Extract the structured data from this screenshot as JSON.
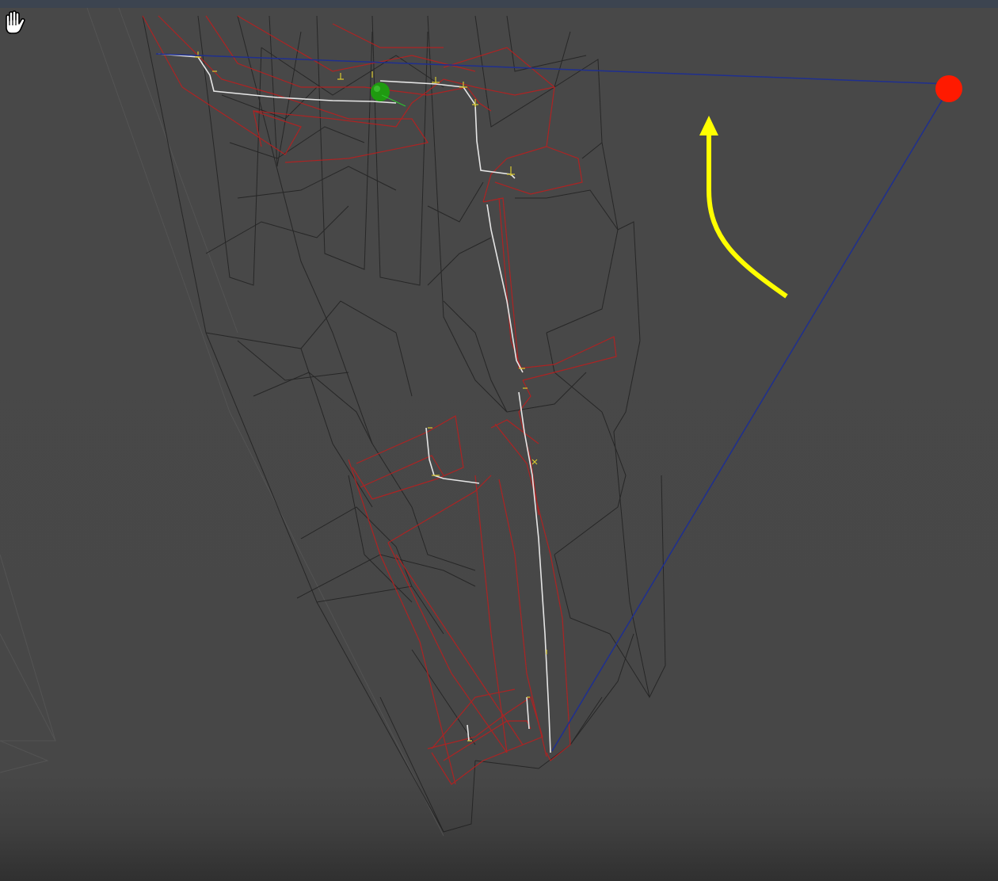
{
  "viewport": {
    "mode": "wireframe",
    "background_color": "#474747",
    "mesh_color": "#1a1a1a",
    "highlight_mesh_color": "#b82020",
    "path_color": "#e6e6e6",
    "path_node_color": "#d8c830",
    "gizmo_line_color": "#1f2f8f",
    "target_marker_color": "#ff1a00",
    "selection_marker_color": "#1f9a10",
    "annotation_arrow_color": "#ffff00"
  },
  "icons": {
    "target_marker": "red-dot-icon",
    "selection_marker": "green-dot-icon",
    "annotation_arrow": "curved-arrow-up-icon",
    "cursor": "hand-pan-cursor-icon"
  }
}
